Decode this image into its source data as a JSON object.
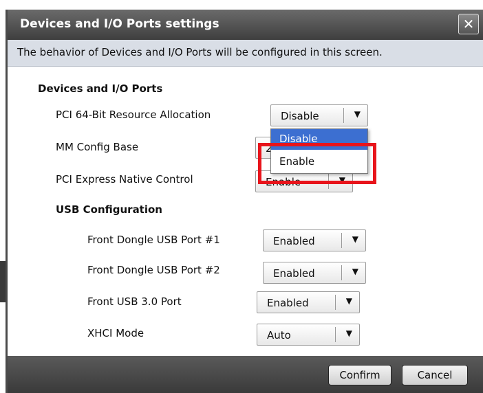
{
  "dialog": {
    "title": "Devices and I/O Ports settings",
    "close_label": "✕",
    "info": "The behavior of Devices and I/O Ports will be configured in this screen."
  },
  "sections": {
    "devices": {
      "title": "Devices and I/O Ports",
      "pci64": {
        "label": "PCI 64-Bit Resource Allocation",
        "value": "Disable"
      },
      "mmconfig": {
        "label": "MM Config Base",
        "value": "2"
      },
      "pcie_native": {
        "label": "PCI Express Native Control",
        "value": "Enable"
      }
    },
    "usb": {
      "title": "USB Configuration",
      "dongle1": {
        "label": "Front Dongle USB Port #1",
        "value": "Enabled"
      },
      "dongle2": {
        "label": "Front Dongle USB Port #2",
        "value": "Enabled"
      },
      "usb30": {
        "label": "Front USB 3.0 Port",
        "value": "Enabled"
      },
      "xhci": {
        "label": "XHCI Mode",
        "value": "Auto"
      }
    }
  },
  "dropdown": {
    "options": [
      "Disable",
      "Enable"
    ],
    "selected": "Disable"
  },
  "footer": {
    "confirm_label": "Confirm",
    "cancel_label": "Cancel"
  },
  "icons": {
    "arrow": "chevron-down-icon"
  },
  "colors": {
    "titlebar": "#4a4a4a",
    "infobar": "#d9dee6",
    "selection": "#3c6fd1",
    "highlight": "#e8141b"
  }
}
